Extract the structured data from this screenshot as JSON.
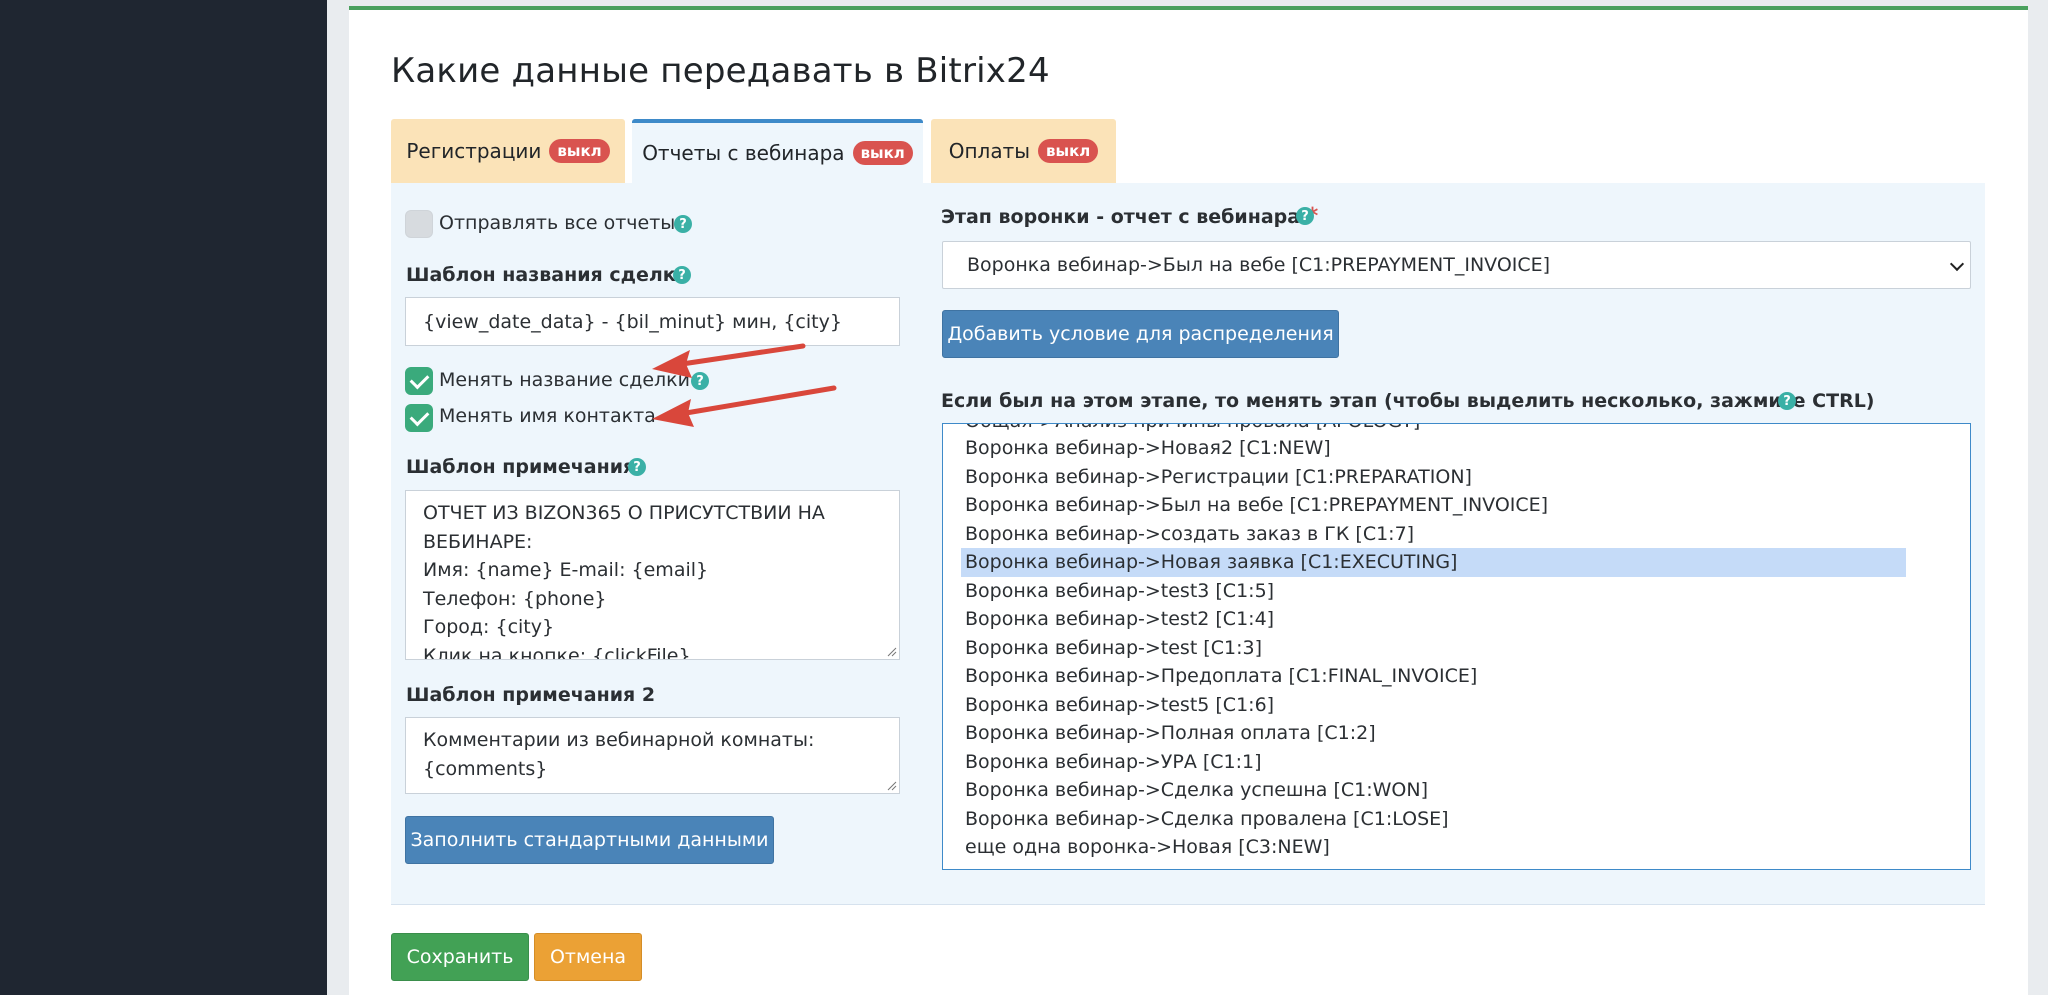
{
  "page": {
    "title": "Какие данные передавать в Bitrix24"
  },
  "tabs": [
    {
      "label": "Регистрации",
      "badge": "выкл",
      "active": false
    },
    {
      "label": "Отчеты с вебинара",
      "badge": "выкл",
      "active": true
    },
    {
      "label": "Оплаты",
      "badge": "выкл",
      "active": false
    }
  ],
  "left": {
    "send_all": {
      "label": "Отправлять все отчеты",
      "checked": false
    },
    "deal_name_template": {
      "label": "Шаблон названия сделки",
      "value": "{view_date_data}  - {bil_minut} мин, {city}"
    },
    "change_deal_name": {
      "label": "Менять название сделки",
      "checked": true
    },
    "change_contact_name": {
      "label": "Менять имя контакта",
      "checked": true
    },
    "note_template": {
      "label": "Шаблон примечания",
      "lines": [
        "ОТЧЕТ ИЗ BIZON365 О ПРИСУТСТВИИ НА",
        "ВЕБИНАРЕ:",
        "Имя: {name} E-mail: {email}",
        "Телефон: {phone}",
        "Город: {city}",
        "Клик на кнопке: {clickFile}"
      ]
    },
    "note_template_2": {
      "label": "Шаблон примечания 2",
      "lines": [
        "Комментарии из вебинарной комнаты:",
        "{comments}"
      ]
    },
    "fill_default_button": "Заполнить стандартными данными"
  },
  "right": {
    "funnel_stage": {
      "label": "Этап воронки - отчет с вебинара",
      "required_mark": "*",
      "selected": "Воронка вебинар->Был на вебе [C1:PREPAYMENT_INVOICE]"
    },
    "add_condition_button": "Добавить условие для распределения",
    "change_stage": {
      "label": "Если был на этом этапе, то менять этап (чтобы выделить несколько, зажмите CTRL)",
      "options": [
        {
          "text": "Общая->Анализ причины провала [APOLOGY]",
          "selected": false
        },
        {
          "text": "Воронка вебинар->Новая2 [C1:NEW]",
          "selected": false
        },
        {
          "text": "Воронка вебинар->Регистрации [C1:PREPARATION]",
          "selected": false
        },
        {
          "text": "Воронка вебинар->Был на вебе [C1:PREPAYMENT_INVOICE]",
          "selected": false
        },
        {
          "text": "Воронка вебинар->создать заказ в ГК [C1:7]",
          "selected": false
        },
        {
          "text": "Воронка вебинар->Новая заявка [C1:EXECUTING]",
          "selected": true
        },
        {
          "text": "Воронка вебинар->test3 [C1:5]",
          "selected": false
        },
        {
          "text": "Воронка вебинар->test2 [C1:4]",
          "selected": false
        },
        {
          "text": "Воронка вебинар->test [C1:3]",
          "selected": false
        },
        {
          "text": "Воронка вебинар->Предоплата [C1:FINAL_INVOICE]",
          "selected": false
        },
        {
          "text": "Воронка вебинар->test5 [C1:6]",
          "selected": false
        },
        {
          "text": "Воронка вебинар->Полная оплата [C1:2]",
          "selected": false
        },
        {
          "text": "Воронка вебинар->УРА [C1:1]",
          "selected": false
        },
        {
          "text": "Воронка вебинар->Сделка успешна [C1:WON]",
          "selected": false
        },
        {
          "text": "Воронка вебинар->Сделка провалена [C1:LOSE]",
          "selected": false
        },
        {
          "text": "еще одна воронка->Новая [C3:NEW]",
          "selected": false
        }
      ]
    }
  },
  "footer": {
    "save": "Сохранить",
    "cancel": "Отмена"
  },
  "help_glyph": "?",
  "colors": {
    "sidebar": "#1f2631",
    "accent_green": "#42a155",
    "badge_red": "#d9534f",
    "primary_blue": "#4a84b8",
    "annotation_arrow": "#d9473b"
  }
}
